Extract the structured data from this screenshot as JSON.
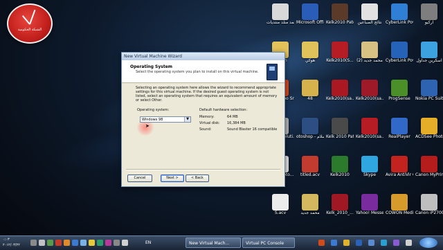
{
  "clock": {
    "label": "الشبكة الحكومية"
  },
  "wizard": {
    "title": "New Virtual Machine Wizard",
    "heading": "Operating System",
    "subheading": "Select the operating system you plan to install on this virtual machine.",
    "intro": "Selecting an operating system here allows the wizard to recommend appropriate settings for this virtual machine. If the desired guest operating system is not listed, select an operating system that requires an equivalent amount of memory or select Other.",
    "os_label": "Operating system:",
    "os_value": "Windows 98",
    "hw_title": "Default hardware selection:",
    "hw_rows": [
      {
        "k": "Memory:",
        "v": "64 MB"
      },
      {
        "k": "Virtual disk:",
        "v": "16,384 MB"
      },
      {
        "k": "Sound:",
        "v": "Sound Blaster 16 compatible"
      }
    ],
    "buttons": {
      "cancel": "Cancel",
      "next": "Next >",
      "back": "< Back"
    }
  },
  "desktop_icons": [
    {
      "label": "محمد منلذ منتديات",
      "color": "#d9d9d9"
    },
    {
      "label": "Microsoft Office Wo...",
      "color": "#2a5db8"
    },
    {
      "label": "Kelk2010 Patch v1",
      "color": "#5c3a2a"
    },
    {
      "label": "نتائج الصباعين",
      "color": "#e2e2e2"
    },
    {
      "label": "CyberLink PowerDVD",
      "color": "#2f7fd6"
    },
    {
      "label": "ارکيو",
      "color": "#7e7e7e"
    },
    {
      "label": "omran",
      "color": "#e4c35a"
    },
    {
      "label": "هوكي",
      "color": "#e0c25a"
    },
    {
      "label": "Kelk2010(S...",
      "color": "#b61c24"
    },
    {
      "label": "محمد جديد (2)",
      "color": "#d7c283"
    },
    {
      "label": "CyberLink PowerDVD 10",
      "color": "#2563b9"
    },
    {
      "label": "اسكرين جداول",
      "color": "#3da2e0"
    },
    {
      "label": "Ashampoo Snap 4",
      "color": "#d84a1e"
    },
    {
      "label": "48",
      "color": "#d6b24d"
    },
    {
      "label": "Kelk2010(sa...",
      "color": "#aa1822"
    },
    {
      "label": "Kelk2010(sa...",
      "color": "#9e1a28"
    },
    {
      "label": "ProgSense",
      "color": "#4b8f29"
    },
    {
      "label": "Nokia PC Suite",
      "color": "#2d63b1"
    },
    {
      "label": "Canon Soluti...",
      "color": "#b8b8b8"
    },
    {
      "label": "otoshop - رائد الاسلام",
      "color": "#2c4e82"
    },
    {
      "label": "Kelk 2010 Patcher v2.2",
      "color": "#4a4a4a"
    },
    {
      "label": "Kelk2010(sa...",
      "color": "#b61c24"
    },
    {
      "label": "RealPlayer",
      "color": "#3169c8"
    },
    {
      "label": "ACDSee Photo ...",
      "color": "#e5ad28"
    },
    {
      "label": "Easy-Photo...",
      "color": "#e6e6e6"
    },
    {
      "label": "titled.acv",
      "color": "#c13b2f"
    },
    {
      "label": "Kelk2010",
      "color": "#2c7a2c"
    },
    {
      "label": "Skype",
      "color": "#2fa6e0"
    },
    {
      "label": "Avira AntiVir Control Ce...",
      "color": "#c3231e"
    },
    {
      "label": "Canon MyPrinter",
      "color": "#b51c1c"
    },
    {
      "label": "S.acv",
      "color": "#ececec"
    },
    {
      "label": "محمد جديد",
      "color": "#d3b860"
    },
    {
      "label": "Kelk_2010_...",
      "color": "#9f1824"
    },
    {
      "label": "Yahoo! Messenger",
      "color": "#7a2b9e"
    },
    {
      "label": "COWON Media Cent...",
      "color": "#d69b2a"
    },
    {
      "label": "Canon iP2700 seri...",
      "color": "#bfbfbf"
    }
  ],
  "taskbar": {
    "task1": "New Virtual Mach...",
    "task2": "Virtual PC Console",
    "lang": "EN",
    "time": "٠:٠٣",
    "date": "٢٠١٢/٠٣/٢٢"
  }
}
